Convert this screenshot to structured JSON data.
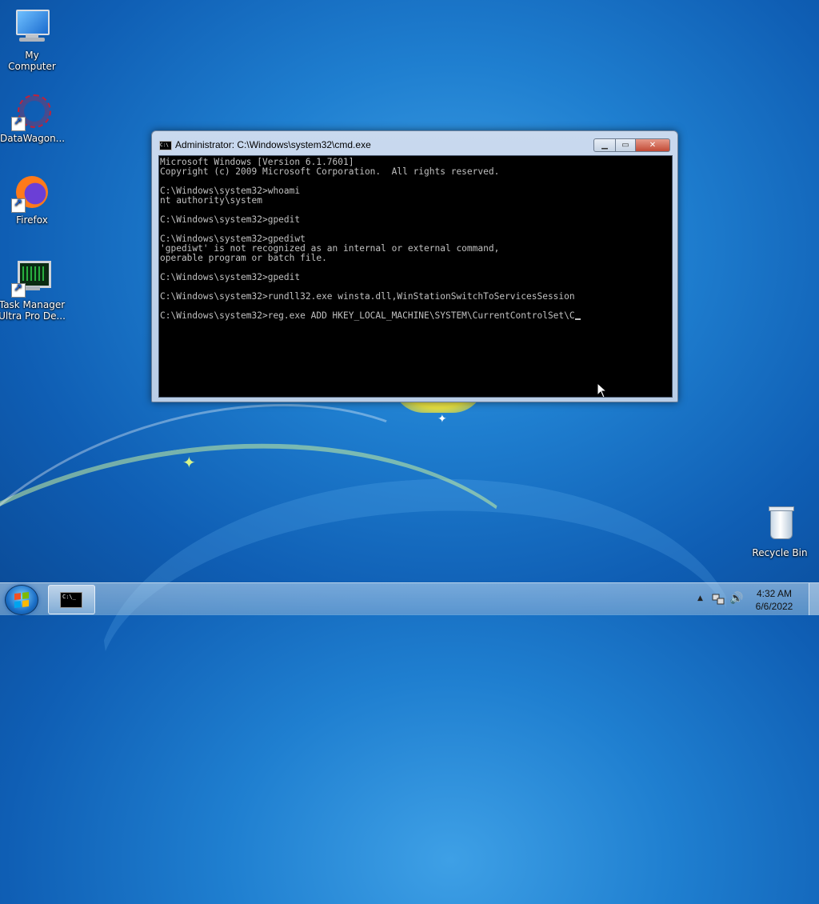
{
  "desktop": {
    "icons": [
      {
        "label": "My Computer",
        "icon": "computer-icon"
      },
      {
        "label": "DataWagon...",
        "icon": "datawagon-icon"
      },
      {
        "label": "Firefox",
        "icon": "firefox-icon"
      },
      {
        "label": "Task Manager Ultra Pro De...",
        "icon": "task-manager-icon"
      },
      {
        "label": "Recycle Bin",
        "icon": "recycle-bin-icon"
      }
    ]
  },
  "window": {
    "title": "Administrator: C:\\Windows\\system32\\cmd.exe",
    "title_icon_text": "C:\\",
    "buttons": {
      "minimize": "minimize-icon",
      "maximize": "maximize-icon",
      "close": "close-icon"
    },
    "console_lines": [
      "Microsoft Windows [Version 6.1.7601]",
      "Copyright (c) 2009 Microsoft Corporation.  All rights reserved.",
      "",
      "C:\\Windows\\system32>whoami",
      "nt authority\\system",
      "",
      "C:\\Windows\\system32>gpedit",
      "",
      "C:\\Windows\\system32>gpediwt",
      "'gpediwt' is not recognized as an internal or external command,",
      "operable program or batch file.",
      "",
      "C:\\Windows\\system32>gpedit",
      "",
      "C:\\Windows\\system32>rundll32.exe winsta.dll,WinStationSwitchToServicesSession",
      "",
      "C:\\Windows\\system32>reg.exe ADD HKEY_LOCAL_MACHINE\\SYSTEM\\CurrentControlSet\\C"
    ]
  },
  "taskbar": {
    "start": "start-button",
    "app_icon_text": "C:\\_",
    "tray": {
      "time": "4:32 AM",
      "date": "6/6/2022"
    }
  }
}
